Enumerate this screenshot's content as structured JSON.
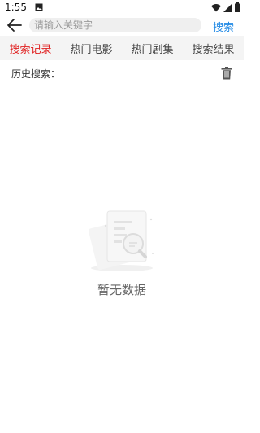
{
  "status_bar": {
    "time": "1:55"
  },
  "search": {
    "placeholder": "请输入关键字",
    "button_label": "搜索"
  },
  "tabs": [
    {
      "label": "搜索记录",
      "active": true
    },
    {
      "label": "热门电影",
      "active": false
    },
    {
      "label": "热门剧集",
      "active": false
    },
    {
      "label": "搜索结果",
      "active": false
    }
  ],
  "history": {
    "label": "历史搜索："
  },
  "empty_state": {
    "text": "暂无数据"
  },
  "colors": {
    "accent": "#1e88e5",
    "active_tab": "#e02020",
    "tab_bg": "#f4f4f4"
  },
  "icons": [
    "image-icon",
    "wifi-icon",
    "signal-icon",
    "battery-icon",
    "back-arrow-icon",
    "trash-icon",
    "empty-document-icon"
  ]
}
